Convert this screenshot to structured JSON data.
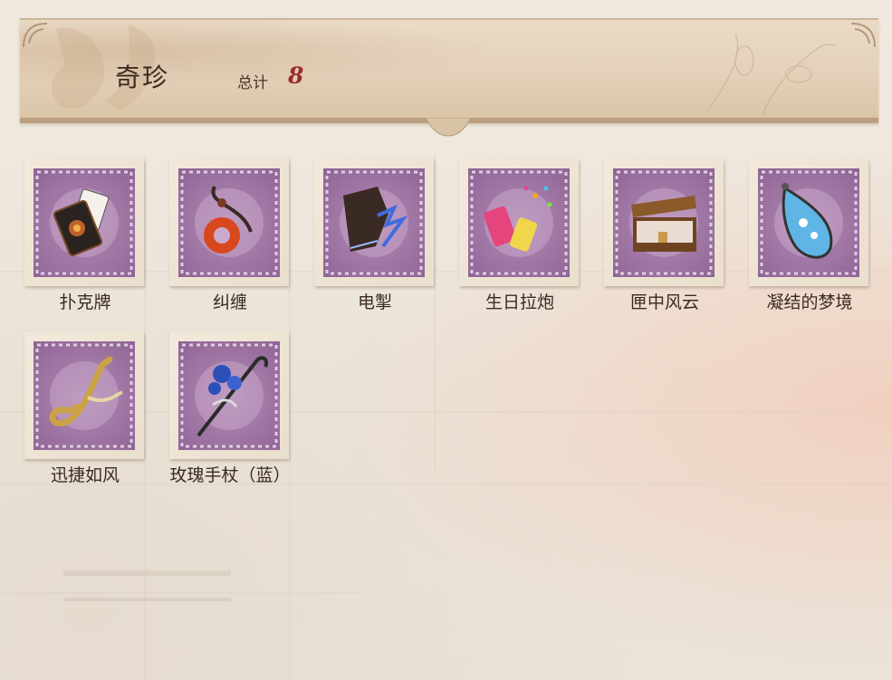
{
  "header": {
    "title": "奇珍",
    "total_label": "总计",
    "total_value": "8"
  },
  "items": [
    {
      "label": "扑克牌",
      "icon": "poker-cards-icon",
      "accent": "#c0622a"
    },
    {
      "label": "纠缠",
      "icon": "amulet-pendant-icon",
      "accent": "#d9471e"
    },
    {
      "label": "电掣",
      "icon": "electric-glove-icon",
      "accent": "#3f6be0"
    },
    {
      "label": "生日拉炮",
      "icon": "party-popper-icon",
      "accent": "#e4457c"
    },
    {
      "label": "匣中风云",
      "icon": "treasure-box-icon",
      "accent": "#8b5a2b"
    },
    {
      "label": "凝结的梦境",
      "icon": "dream-crystal-icon",
      "accent": "#5fb5e6"
    },
    {
      "label": "迅捷如风",
      "icon": "saxophone-icon",
      "accent": "#c9a24a"
    },
    {
      "label": "玫瑰手杖（蓝）",
      "icon": "blue-rose-cane-icon",
      "accent": "#2d4fb8"
    }
  ]
}
